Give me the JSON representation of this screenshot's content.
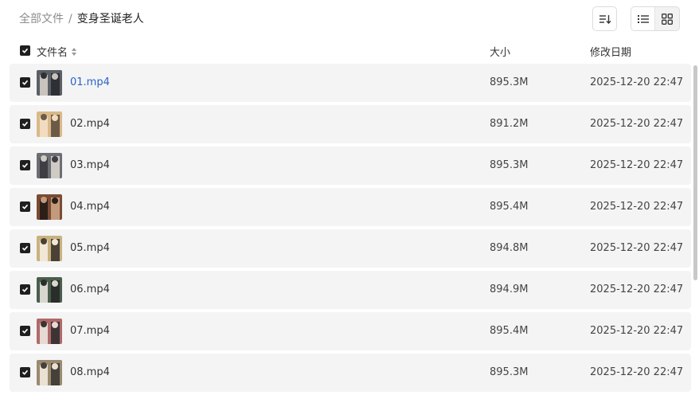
{
  "breadcrumb": {
    "root": "全部文件",
    "separator": "/",
    "current": "变身圣诞老人"
  },
  "toolbar": {
    "sort_icon": "sort-icon",
    "list_view_icon": "list-view-icon",
    "grid_view_icon": "grid-view-icon",
    "active_view": "list"
  },
  "columns": {
    "name": "文件名",
    "size": "大小",
    "modified": "修改日期"
  },
  "files": [
    {
      "name": "01.mp4",
      "size": "895.3M",
      "date": "2025-12-20 22:47",
      "checked": true,
      "highlight": true
    },
    {
      "name": "02.mp4",
      "size": "891.2M",
      "date": "2025-12-20 22:47",
      "checked": true
    },
    {
      "name": "03.mp4",
      "size": "895.3M",
      "date": "2025-12-20 22:47",
      "checked": true
    },
    {
      "name": "04.mp4",
      "size": "895.4M",
      "date": "2025-12-20 22:47",
      "checked": true
    },
    {
      "name": "05.mp4",
      "size": "894.8M",
      "date": "2025-12-20 22:47",
      "checked": true
    },
    {
      "name": "06.mp4",
      "size": "894.9M",
      "date": "2025-12-20 22:47",
      "checked": true
    },
    {
      "name": "07.mp4",
      "size": "895.4M",
      "date": "2025-12-20 22:47",
      "checked": true
    },
    {
      "name": "08.mp4",
      "size": "895.3M",
      "date": "2025-12-20 22:47",
      "checked": true
    }
  ],
  "colors": {
    "accent_link": "#2a62c9",
    "row_bg": "#f4f4f4",
    "checkbox": "#1f1f1f"
  }
}
